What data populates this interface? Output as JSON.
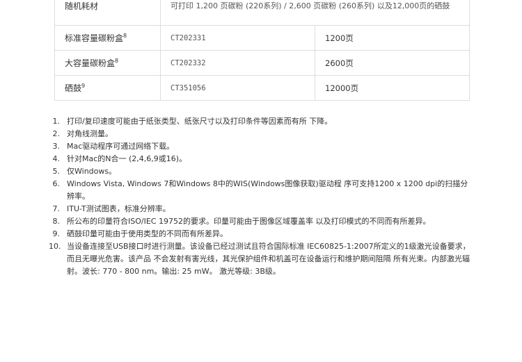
{
  "table": {
    "rows": [
      {
        "name": "随机耗材",
        "desc": "可打印 1,200 页碳粉 (220系列) / 2,600 页碳粉 (260系列) 以及12,000页的硒鼓"
      },
      {
        "name": "标准容量碳粉盒",
        "sup": "8",
        "model": "CT202331",
        "yield": "1200页"
      },
      {
        "name": "大容量碳粉盒",
        "sup": "8",
        "model": "CT202332",
        "yield": "2600页"
      },
      {
        "name": "硒鼓",
        "sup": "9",
        "model": "CT351056",
        "yield": "12000页"
      }
    ]
  },
  "footnotes": [
    {
      "num": "1.",
      "text": "打印/复印速度可能由于纸张类型、纸张尺寸以及打印条件等因素而有所 下降。"
    },
    {
      "num": "2.",
      "text": "对角线测量。"
    },
    {
      "num": "3.",
      "text": "Mac驱动程序可通过网络下载。"
    },
    {
      "num": "4.",
      "text": "针对Mac的N合一 (2,4,6,9或16)。"
    },
    {
      "num": "5.",
      "text": "仅Windows。"
    },
    {
      "num": "6.",
      "text": "Windows Vista, Windows 7和Windows 8中的WIS(Windows图像获取)驱动程 序可支持1200 x 1200 dpi的扫描分辨率。"
    },
    {
      "num": "7.",
      "text": "ITU-T测试图表，标准分辨率。"
    },
    {
      "num": "8.",
      "text": "所公布的印量符合ISO/IEC 19752的要求。印量可能由于图像区域覆盖率 以及打印模式的不同而有所差异。"
    },
    {
      "num": "9.",
      "text": "硒鼓印量可能由于使用类型的不同而有所差异。"
    },
    {
      "num": "10.",
      "text": "当设备连接至USB接口时进行测量。该设备已经过测试且符合国际标准 IEC60825-1:2007所定义的1级激光设备要求，而且无曝光危害。该产品 不会发射有害光线，其光保护组件和机盖可在设备运行和维护期间阻隔 所有光束。内部激光辐射。波长: 770 - 800 nm。输出: 25 mW。 激光等级: 3B级。"
    }
  ]
}
